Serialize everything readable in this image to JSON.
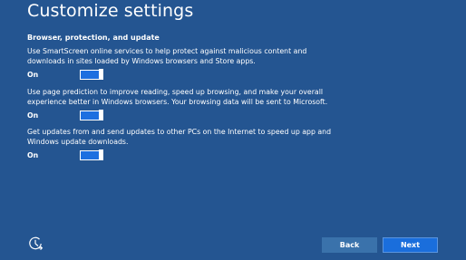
{
  "page": {
    "title": "Customize settings",
    "section_heading": "Browser, protection, and update"
  },
  "settings": [
    {
      "description": "Use SmartScreen online services to help protect against malicious content and downloads in sites loaded by Windows browsers and Store apps.",
      "state_label": "On",
      "enabled": true
    },
    {
      "description": "Use page prediction to improve reading, speed up browsing, and make your overall experience better in Windows browsers. Your browsing data will be sent to Microsoft.",
      "state_label": "On",
      "enabled": true
    },
    {
      "description": "Get updates from and send updates to other PCs on the Internet to speed up app and Windows update downloads.",
      "state_label": "On",
      "enabled": true
    }
  ],
  "footer": {
    "accessibility_icon": "ease-of-access-icon",
    "back_label": "Back",
    "next_label": "Next"
  },
  "colors": {
    "background": "#245591",
    "toggle_on": "#1d6fe0",
    "next_button": "#1a6edc",
    "back_button": "#3a72ab"
  }
}
